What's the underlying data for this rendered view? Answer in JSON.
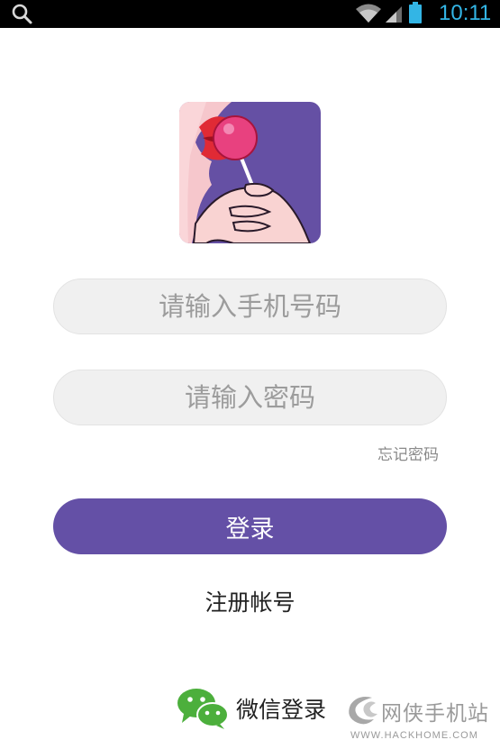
{
  "status_bar": {
    "time": "10:11",
    "icons": [
      "search-icon",
      "wifi-icon",
      "signal-icon",
      "battery-icon"
    ],
    "time_color": "#33b5e5"
  },
  "app": {
    "logo_icon": "lollipop-lips-logo",
    "accent_color": "#6450a6"
  },
  "login_form": {
    "phone_placeholder": "请输入手机号码",
    "password_placeholder": "请输入密码",
    "forgot_password": "忘记密码",
    "login_button": "登录",
    "register_link": "注册帐号"
  },
  "social_login": {
    "wechat_icon": "wechat-icon",
    "wechat_label": "微信登录"
  },
  "watermark": {
    "text": "网侠手机站",
    "url": "WWW.HACKHOME.COM"
  }
}
